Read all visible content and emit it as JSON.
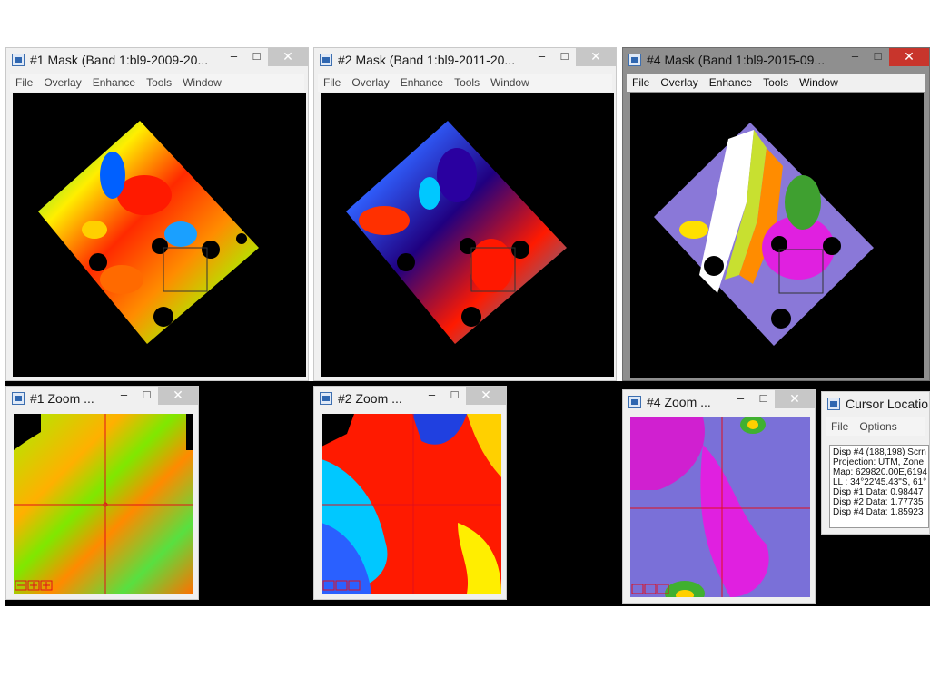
{
  "menu": [
    "File",
    "Overlay",
    "Enhance",
    "Tools",
    "Window"
  ],
  "windows": {
    "w1": {
      "title": "#1 Mask (Band 1:bl9-2009-20..."
    },
    "w2": {
      "title": "#2 Mask (Band 1:bl9-2011-20..."
    },
    "w4": {
      "title": "#4 Mask (Band 1:bl9-2015-09..."
    }
  },
  "zooms": {
    "z1": {
      "title": "#1 Zoom ..."
    },
    "z2": {
      "title": "#2 Zoom ..."
    },
    "z4": {
      "title": "#4 Zoom ..."
    }
  },
  "cursor": {
    "title": "Cursor Locatio",
    "menu": [
      "File",
      "Options"
    ],
    "lines": [
      "Disp #4 (188,198) Scrn",
      "Projection: UTM, Zone",
      "Map: 629820.00E,6194",
      "LL : 34°22'45.43\"S, 61°",
      "Disp #1 Data: 0.98447",
      "Disp #2 Data: 1.77735",
      "Disp #4 Data: 1.85923"
    ]
  },
  "controls": {
    "minimize": "–",
    "maximize": "□",
    "close": "✕"
  },
  "colors": {
    "crosshair": "#e0101c",
    "active_close": "#c8352c"
  }
}
